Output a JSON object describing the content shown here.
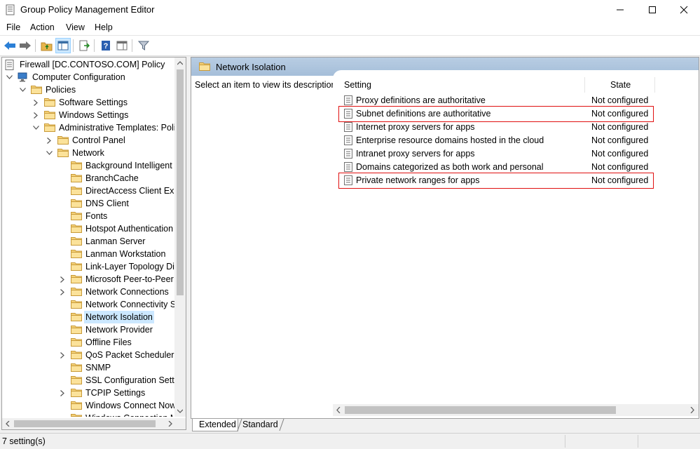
{
  "window": {
    "title": "Group Policy Management Editor"
  },
  "menu": [
    "File",
    "Action",
    "View",
    "Help"
  ],
  "tree": {
    "items": [
      {
        "label": "Firewall [DC.CONTOSO.COM] Policy",
        "level": 0,
        "expander": "",
        "icon": "policy-icon"
      },
      {
        "label": "Computer Configuration",
        "level": 1,
        "expander": "expanded",
        "icon": "computer-icon"
      },
      {
        "label": "Policies",
        "level": 2,
        "expander": "expanded",
        "icon": "folder-icon"
      },
      {
        "label": "Software Settings",
        "level": 3,
        "expander": "collapsed",
        "icon": "folder-icon"
      },
      {
        "label": "Windows Settings",
        "level": 3,
        "expander": "collapsed",
        "icon": "folder-icon"
      },
      {
        "label": "Administrative Templates: Polic",
        "level": 3,
        "expander": "expanded",
        "icon": "folder-icon"
      },
      {
        "label": "Control Panel",
        "level": 4,
        "expander": "collapsed",
        "icon": "folder-icon"
      },
      {
        "label": "Network",
        "level": 4,
        "expander": "expanded",
        "icon": "folder-icon"
      },
      {
        "label": "Background Intelligent T",
        "level": 5,
        "expander": "",
        "icon": "folder-icon"
      },
      {
        "label": "BranchCache",
        "level": 5,
        "expander": "",
        "icon": "folder-icon"
      },
      {
        "label": "DirectAccess Client Expe",
        "level": 5,
        "expander": "",
        "icon": "folder-icon"
      },
      {
        "label": "DNS Client",
        "level": 5,
        "expander": "",
        "icon": "folder-icon"
      },
      {
        "label": "Fonts",
        "level": 5,
        "expander": "",
        "icon": "folder-icon"
      },
      {
        "label": "Hotspot Authentication",
        "level": 5,
        "expander": "",
        "icon": "folder-icon"
      },
      {
        "label": "Lanman Server",
        "level": 5,
        "expander": "",
        "icon": "folder-icon"
      },
      {
        "label": "Lanman Workstation",
        "level": 5,
        "expander": "",
        "icon": "folder-icon"
      },
      {
        "label": "Link-Layer Topology Disc",
        "level": 5,
        "expander": "",
        "icon": "folder-icon"
      },
      {
        "label": "Microsoft Peer-to-Peer N",
        "level": 5,
        "expander": "collapsed",
        "icon": "folder-icon"
      },
      {
        "label": "Network Connections",
        "level": 5,
        "expander": "collapsed",
        "icon": "folder-icon"
      },
      {
        "label": "Network Connectivity St",
        "level": 5,
        "expander": "",
        "icon": "folder-icon"
      },
      {
        "label": "Network Isolation",
        "level": 5,
        "expander": "",
        "icon": "folder-icon",
        "selected": true
      },
      {
        "label": "Network Provider",
        "level": 5,
        "expander": "",
        "icon": "folder-icon"
      },
      {
        "label": "Offline Files",
        "level": 5,
        "expander": "",
        "icon": "folder-icon"
      },
      {
        "label": "QoS Packet Scheduler",
        "level": 5,
        "expander": "collapsed",
        "icon": "folder-icon"
      },
      {
        "label": "SNMP",
        "level": 5,
        "expander": "",
        "icon": "folder-icon"
      },
      {
        "label": "SSL Configuration Settin",
        "level": 5,
        "expander": "",
        "icon": "folder-icon"
      },
      {
        "label": "TCPIP Settings",
        "level": 5,
        "expander": "collapsed",
        "icon": "folder-icon"
      },
      {
        "label": "Windows Connect Now",
        "level": 5,
        "expander": "",
        "icon": "folder-icon"
      },
      {
        "label": "Windows Connection M",
        "level": 5,
        "expander": "",
        "icon": "folder-icon"
      }
    ]
  },
  "right_pane": {
    "header_title": "Network Isolation",
    "description": "Select an item to view its description.",
    "columns": [
      "Setting",
      "State"
    ],
    "settings": [
      {
        "name": "Proxy definitions are authoritative",
        "state": "Not configured",
        "highlighted": false
      },
      {
        "name": "Subnet definitions are authoritative",
        "state": "Not configured",
        "highlighted": true
      },
      {
        "name": "Internet proxy servers for apps",
        "state": "Not configured",
        "highlighted": false
      },
      {
        "name": "Enterprise resource domains hosted in the cloud",
        "state": "Not configured",
        "highlighted": false
      },
      {
        "name": "Intranet proxy servers for  apps",
        "state": "Not configured",
        "highlighted": false
      },
      {
        "name": "Domains categorized as both work and personal",
        "state": "Not configured",
        "highlighted": false
      },
      {
        "name": "Private network ranges for  apps",
        "state": "Not configured",
        "highlighted": true
      }
    ]
  },
  "tabs": [
    {
      "label": "Extended",
      "active": true
    },
    {
      "label": "Standard",
      "active": false
    }
  ],
  "status": {
    "text": "7 setting(s)"
  },
  "colors": {
    "highlight_box": "#e01010",
    "selection": "#cce8ff",
    "header_band": "#a5bed9"
  }
}
